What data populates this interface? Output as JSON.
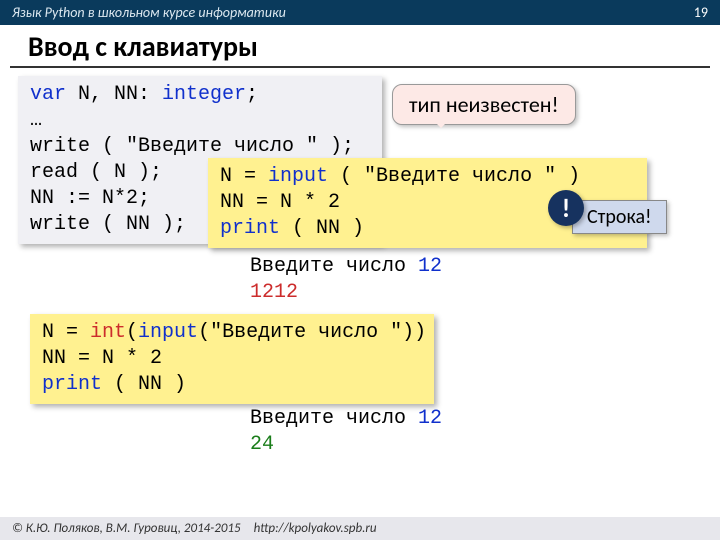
{
  "header": {
    "course": "Язык Python в школьном курсе информатики",
    "page": "19"
  },
  "heading": "Ввод с клавиатуры",
  "pascal": {
    "l1a": "var",
    "l1b": " N, NN: ",
    "l1c": "integer",
    "l1d": ";",
    "l2": "…",
    "l3": "write ( \"Введите число \" );",
    "l4": "read ( N );",
    "l5": "NN := N*2;",
    "l6": "write ( NN );"
  },
  "callout_type": "тип неизвестен!",
  "py1": {
    "l1a": "N = ",
    "l1b": "input",
    "l1c": " ( \"Введите число \" )",
    "l2": "NN = N * 2",
    "l3a": "print",
    "l3b": " ( NN )"
  },
  "bang": "!",
  "callout_str": "Строка!",
  "out1": {
    "prompt": "Введите число ",
    "in": "12",
    "res": "1212"
  },
  "py2": {
    "l1a": "N = ",
    "l1b": "int",
    "l1c": "(",
    "l1d": "input",
    "l1e": "(\"Введите число \"))",
    "l2": "NN = N * 2",
    "l3a": "print",
    "l3b": " ( NN )"
  },
  "out2": {
    "prompt": "Введите число ",
    "in": "12",
    "res": "24"
  },
  "footer": {
    "copyright": "© К.Ю. Поляков, В.М. Гуровиц, 2014-2015",
    "url": "http://kpolyakov.spb.ru"
  }
}
